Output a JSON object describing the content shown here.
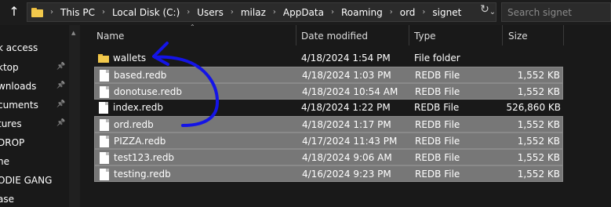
{
  "address_bar": {
    "breadcrumbs": [
      "This PC",
      "Local Disk (C:)",
      "Users",
      "milaz",
      "AppData",
      "Roaming",
      "ord",
      "signet"
    ]
  },
  "search": {
    "placeholder": "Search signet"
  },
  "sidebar": {
    "items": [
      {
        "label": "k access",
        "pinned": false
      },
      {
        "label": "ktop",
        "pinned": true
      },
      {
        "label": "wnloads",
        "pinned": true
      },
      {
        "label": "cuments",
        "pinned": true
      },
      {
        "label": "tures",
        "pinned": true
      },
      {
        "label": "DROP",
        "pinned": false
      },
      {
        "label": "ne",
        "pinned": false
      },
      {
        "label": "ODIE GANG",
        "pinned": false
      },
      {
        "label": "ase",
        "pinned": false
      }
    ]
  },
  "columns": {
    "name": "Name",
    "date": "Date modified",
    "type": "Type",
    "size": "Size"
  },
  "files": [
    {
      "name": "wallets",
      "date": "4/18/2024 1:54 PM",
      "type": "File folder",
      "size": "",
      "kind": "folder",
      "selected": false
    },
    {
      "name": "based.redb",
      "date": "4/18/2024 1:03 PM",
      "type": "REDB File",
      "size": "1,552 KB",
      "kind": "file",
      "selected": true
    },
    {
      "name": "donotuse.redb",
      "date": "4/18/2024 10:54 AM",
      "type": "REDB File",
      "size": "1,552 KB",
      "kind": "file",
      "selected": true
    },
    {
      "name": "index.redb",
      "date": "4/18/2024 1:22 PM",
      "type": "REDB File",
      "size": "526,860 KB",
      "kind": "file",
      "selected": false
    },
    {
      "name": "ord.redb",
      "date": "4/18/2024 1:17 PM",
      "type": "REDB File",
      "size": "1,552 KB",
      "kind": "file",
      "selected": true
    },
    {
      "name": "PIZZA.redb",
      "date": "4/17/2024 11:43 PM",
      "type": "REDB File",
      "size": "1,552 KB",
      "kind": "file",
      "selected": true
    },
    {
      "name": "test123.redb",
      "date": "4/18/2024 9:06 AM",
      "type": "REDB File",
      "size": "1,552 KB",
      "kind": "file",
      "selected": true
    },
    {
      "name": "testing.redb",
      "date": "4/16/2024 9:23 PM",
      "type": "REDB File",
      "size": "1,552 KB",
      "kind": "file",
      "selected": true
    }
  ],
  "colors": {
    "selection": "#777777",
    "annotation_arrow": "#1414e6",
    "folder": "#f2c94c"
  }
}
